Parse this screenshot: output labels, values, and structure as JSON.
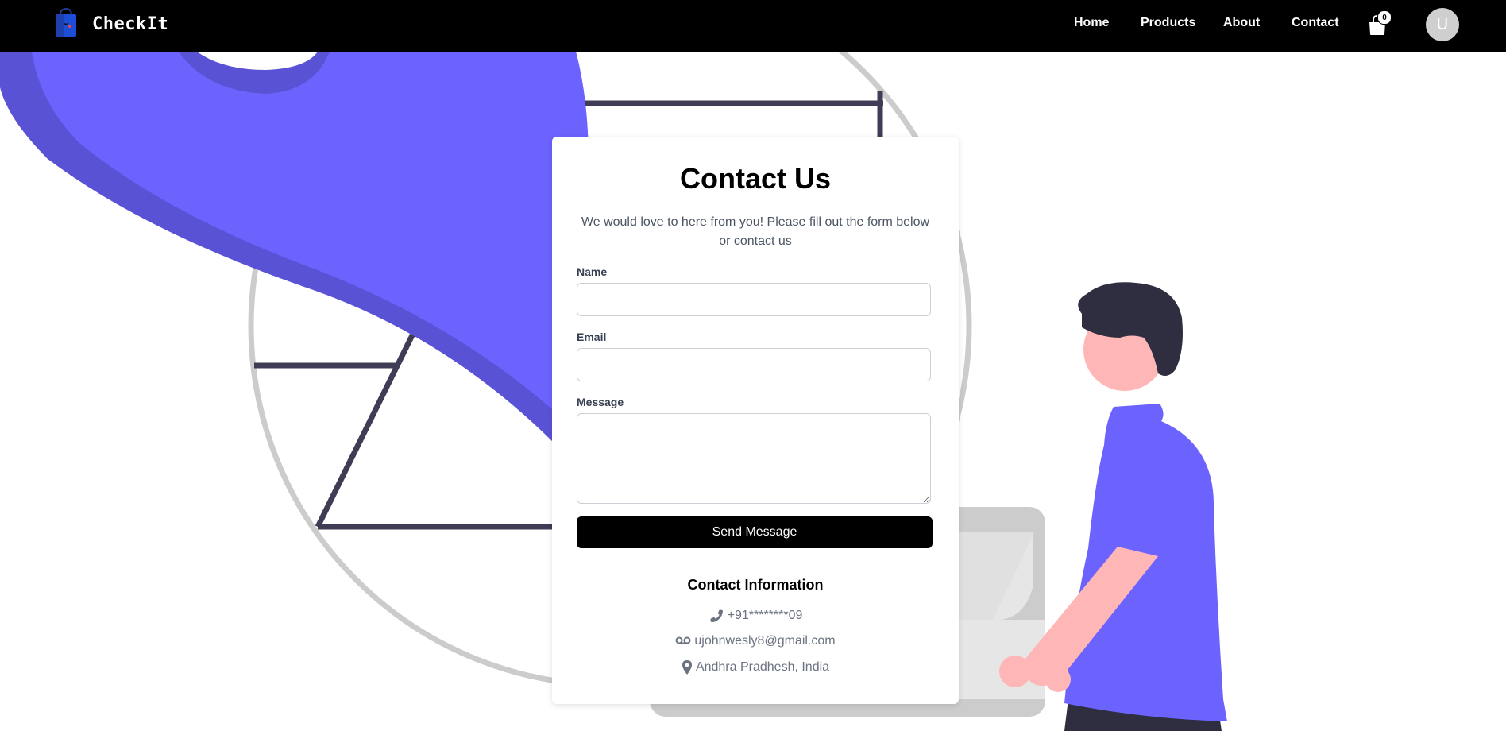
{
  "nav": {
    "brand": "CheckIt",
    "links": [
      "Home",
      "Products",
      "About",
      "Contact"
    ],
    "cart_count": "0",
    "avatar_initial": "U"
  },
  "contact": {
    "title": "Contact Us",
    "subtitle": "We would love to here from you! Please fill out the form below or contact us",
    "name_label": "Name",
    "email_label": "Email",
    "message_label": "Message",
    "name_value": "",
    "email_value": "",
    "message_value": "",
    "send_label": "Send Message"
  },
  "info": {
    "title": "Contact Information",
    "phone": "+91********09",
    "email": "ujohnwesly8@gmail.com",
    "location": "Andhra Pradhesh, India",
    "icons": [
      "phone-icon",
      "voicemail-icon",
      "map-pin-icon"
    ]
  },
  "colors": {
    "navbar": "#000000",
    "accent": "#6c63ff",
    "accent_dark": "#5a52d5",
    "dark_line": "#3f3d56",
    "skin": "#ffb6b6",
    "hair": "#2f2e41",
    "grey_circle": "#cccccc"
  }
}
